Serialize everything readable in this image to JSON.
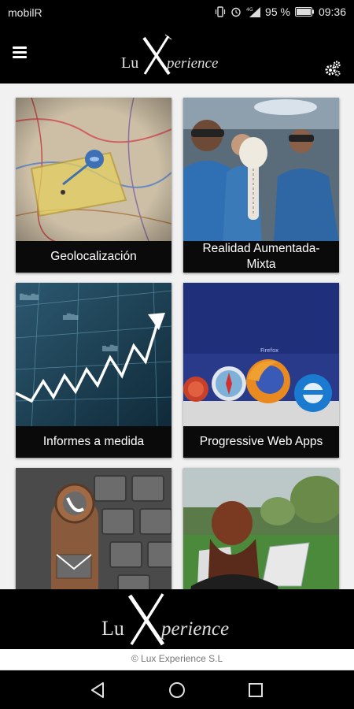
{
  "status_bar": {
    "carrier": "mobilR",
    "battery_percent": "95 %",
    "time": "09:36",
    "icons": [
      "vibrate-icon",
      "alarm-icon",
      "signal-icon",
      "battery-icon"
    ]
  },
  "header": {
    "logo_prefix": "Lu",
    "logo_x": "X",
    "logo_suffix": "perience",
    "menu_icon": "hamburger-menu-icon",
    "settings_icon": "gears-icon"
  },
  "tiles": [
    {
      "label": "Geolocalización",
      "image": "map-with-pin"
    },
    {
      "label": "Realidad Aumentada-Mixta",
      "image": "surgeons-ar-headsets"
    },
    {
      "label": "Informes a medida",
      "image": "stock-chart-arrow"
    },
    {
      "label": "Progressive Web Apps",
      "image": "browser-logos"
    },
    {
      "label": "",
      "image": "phone-keyboard-stamp"
    },
    {
      "label": "",
      "image": "person-reading-map-field"
    }
  ],
  "footer": {
    "logo_prefix": "Lu",
    "logo_x": "X",
    "logo_suffix": "perience",
    "copyright": "© Lux Experience S.L"
  },
  "nav_bar": {
    "icons": [
      "back-icon",
      "home-icon",
      "recent-apps-icon"
    ]
  },
  "colors": {
    "background": "#000000",
    "content_bg": "#f1f1f1",
    "label_bg": "#0a0a0a",
    "label_text": "#ffffff"
  }
}
